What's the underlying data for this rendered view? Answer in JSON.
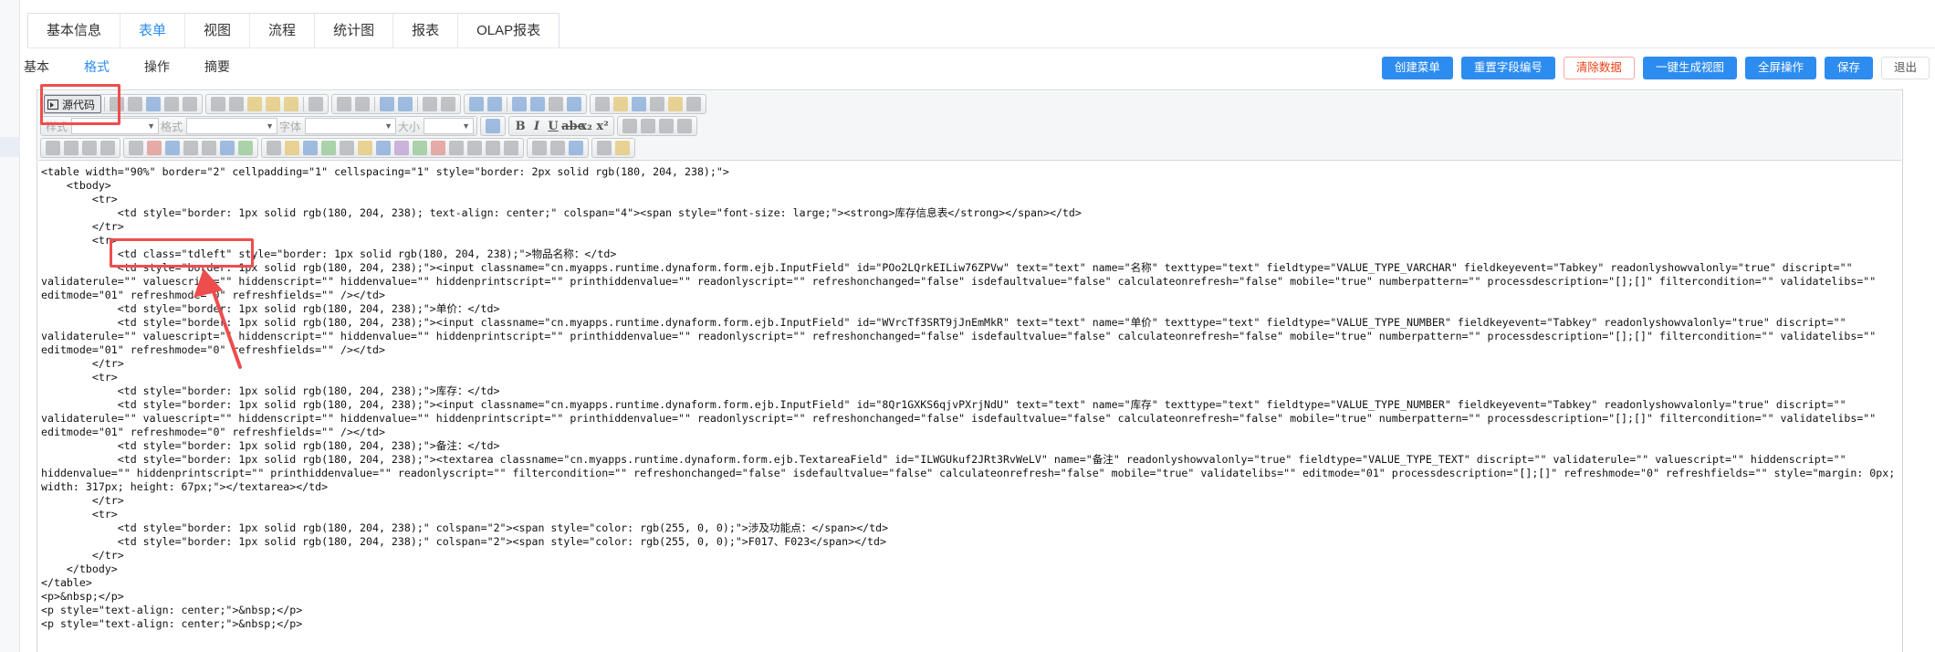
{
  "main_tabs": [
    "基本信息",
    "表单",
    "视图",
    "流程",
    "统计图",
    "报表",
    "OLAP报表"
  ],
  "main_tab_active": 1,
  "sub_tabs": [
    "基本",
    "格式",
    "操作",
    "摘要"
  ],
  "sub_tab_active": 1,
  "actions": {
    "create_menu": "创建菜单",
    "reset_field_numbers": "重置字段编号",
    "clear_data": "清除数据",
    "generate_view": "一键生成视图",
    "fullscreen": "全屏操作",
    "save": "保存",
    "exit": "退出"
  },
  "toolbar": {
    "source_label": "源代码",
    "style_label": "样式",
    "format_label": "格式",
    "font_label": "字体",
    "size_label": "大小"
  },
  "code_lines": [
    "<table width=\"90%\" border=\"2\" cellpadding=\"1\" cellspacing=\"1\" style=\"border: 2px solid rgb(180, 204, 238);\">",
    "    <tbody>",
    "        <tr>",
    "            <td style=\"border: 1px solid rgb(180, 204, 238); text-align: center;\" colspan=\"4\"><span style=\"font-size: large;\"><strong>库存信息表</strong></span></td>",
    "        </tr>",
    "        <tr>",
    "            <td class=\"tdleft\" style=\"border: 1px solid rgb(180, 204, 238);\">物品名称：</td>",
    "            <td style=\"border: 1px solid rgb(180, 204, 238);\"><input classname=\"cn.myapps.runtime.dynaform.form.ejb.InputField\" id=\"POo2LQrkEILiw76ZPVw\" text=\"text\" name=\"名称\" texttype=\"text\" fieldtype=\"VALUE_TYPE_VARCHAR\" fieldkeyevent=\"Tabkey\" readonlyshowvalonly=\"true\" discript=\"\"",
    "validaterule=\"\" valuescript=\"\" hiddenscript=\"\" hiddenvalue=\"\" hiddenprintscript=\"\" printhiddenvalue=\"\" readonlyscript=\"\" refreshonchanged=\"false\" isdefaultvalue=\"false\" calculateonrefresh=\"false\" mobile=\"true\" numberpattern=\"\" processdescription=\"[];[]\" filtercondition=\"\" validatelibs=\"\"",
    "editmode=\"01\" refreshmode=\"0\" refreshfields=\"\" /></td>",
    "            <td style=\"border: 1px solid rgb(180, 204, 238);\">单价：</td>",
    "            <td style=\"border: 1px solid rgb(180, 204, 238);\"><input classname=\"cn.myapps.runtime.dynaform.form.ejb.InputField\" id=\"WVrcTf3SRT9jJnEmMkR\" text=\"text\" name=\"单价\" texttype=\"text\" fieldtype=\"VALUE_TYPE_NUMBER\" fieldkeyevent=\"Tabkey\" readonlyshowvalonly=\"true\" discript=\"\"",
    "validaterule=\"\" valuescript=\"\" hiddenscript=\"\" hiddenvalue=\"\" hiddenprintscript=\"\" printhiddenvalue=\"\" readonlyscript=\"\" refreshonchanged=\"false\" isdefaultvalue=\"false\" calculateonrefresh=\"false\" mobile=\"true\" numberpattern=\"\" processdescription=\"[];[]\" filtercondition=\"\" validatelibs=\"\"",
    "editmode=\"01\" refreshmode=\"0\" refreshfields=\"\" /></td>",
    "        </tr>",
    "        <tr>",
    "            <td style=\"border: 1px solid rgb(180, 204, 238);\">库存：</td>",
    "            <td style=\"border: 1px solid rgb(180, 204, 238);\"><input classname=\"cn.myapps.runtime.dynaform.form.ejb.InputField\" id=\"8Qr1GXKS6qjvPXrjNdU\" text=\"text\" name=\"库存\" texttype=\"text\" fieldtype=\"VALUE_TYPE_NUMBER\" fieldkeyevent=\"Tabkey\" readonlyshowvalonly=\"true\" discript=\"\"",
    "validaterule=\"\" valuescript=\"\" hiddenscript=\"\" hiddenvalue=\"\" hiddenprintscript=\"\" printhiddenvalue=\"\" readonlyscript=\"\" refreshonchanged=\"false\" isdefaultvalue=\"false\" calculateonrefresh=\"false\" mobile=\"true\" numberpattern=\"\" processdescription=\"[];[]\" filtercondition=\"\" validatelibs=\"\"",
    "editmode=\"01\" refreshmode=\"0\" refreshfields=\"\" /></td>",
    "            <td style=\"border: 1px solid rgb(180, 204, 238);\">备注：</td>",
    "            <td style=\"border: 1px solid rgb(180, 204, 238);\"><textarea classname=\"cn.myapps.runtime.dynaform.form.ejb.TextareaField\" id=\"ILWGUkuf2JRt3RvWeLV\" name=\"备注\" readonlyshowvalonly=\"true\" fieldtype=\"VALUE_TYPE_TEXT\" discript=\"\" validaterule=\"\" valuescript=\"\" hiddenscript=\"\"",
    "hiddenvalue=\"\" hiddenprintscript=\"\" printhiddenvalue=\"\" readonlyscript=\"\" filtercondition=\"\" refreshonchanged=\"false\" isdefaultvalue=\"false\" calculateonrefresh=\"false\" mobile=\"true\" validatelibs=\"\" editmode=\"01\" processdescription=\"[];[]\" refreshmode=\"0\" refreshfields=\"\" style=\"margin: 0px;",
    "width: 317px; height: 67px;\"></textarea></td>",
    "        </tr>",
    "        <tr>",
    "            <td style=\"border: 1px solid rgb(180, 204, 238);\" colspan=\"2\"><span style=\"color: rgb(255, 0, 0);\">涉及功能点：</span></td>",
    "            <td style=\"border: 1px solid rgb(180, 204, 238);\" colspan=\"2\"><span style=\"color: rgb(255, 0, 0);\">F017、F023</span></td>",
    "        </tr>",
    "    </tbody>",
    "</table>",
    "<p>&nbsp;</p>",
    "<p style=\"text-align: center;\">&nbsp;</p>",
    "<p style=\"text-align: center;\">&nbsp;</p>"
  ],
  "colors": {
    "accent": "#2d8cf0",
    "highlight": "#ee4d4d",
    "danger": "#ed4014"
  }
}
